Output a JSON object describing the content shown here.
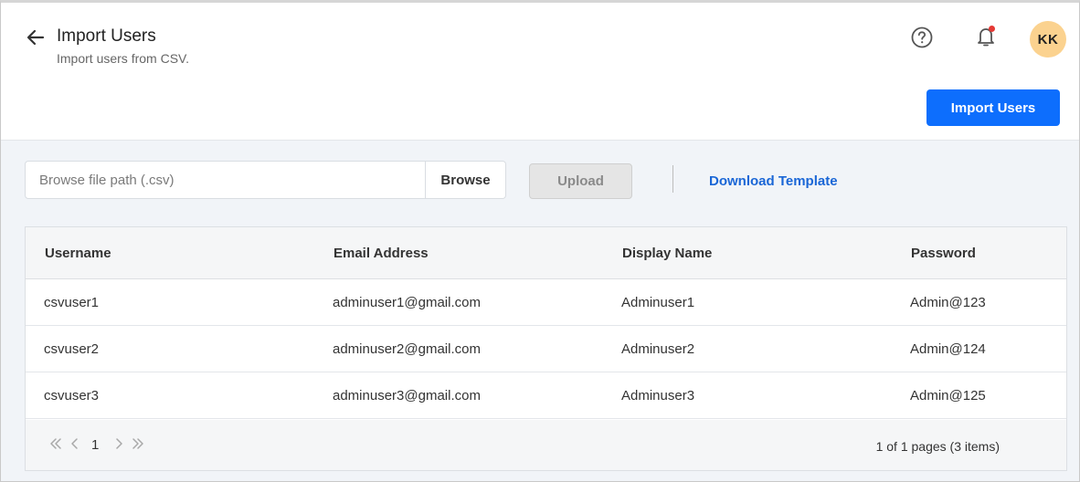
{
  "header": {
    "title": "Import Users",
    "subtitle": "Import users from CSV.",
    "avatar_initials": "KK",
    "import_button": "Import Users"
  },
  "icons": {
    "back": "arrow-left-icon",
    "help": "help-circle-icon",
    "notifications": "bell-icon"
  },
  "upload_bar": {
    "file_placeholder": "Browse file path (.csv)",
    "file_value": "",
    "browse_label": "Browse",
    "upload_label": "Upload",
    "download_label": "Download Template"
  },
  "table": {
    "columns": [
      "Username",
      "Email Address",
      "Display Name",
      "Password"
    ],
    "rows": [
      [
        "csvuser1",
        "adminuser1@gmail.com",
        "Adminuser1",
        "Admin@123"
      ],
      [
        "csvuser2",
        "adminuser2@gmail.com",
        "Adminuser2",
        "Admin@124"
      ],
      [
        "csvuser3",
        "adminuser3@gmail.com",
        "Adminuser3",
        "Admin@125"
      ]
    ]
  },
  "pager": {
    "current_page": "1",
    "info": "1 of 1 pages (3 items)"
  },
  "colors": {
    "primary": "#0d6efd",
    "link": "#1a66d6",
    "avatar_bg": "#fbd28f",
    "notification_dot": "#e53935",
    "page_bg": "#f1f4f8"
  }
}
